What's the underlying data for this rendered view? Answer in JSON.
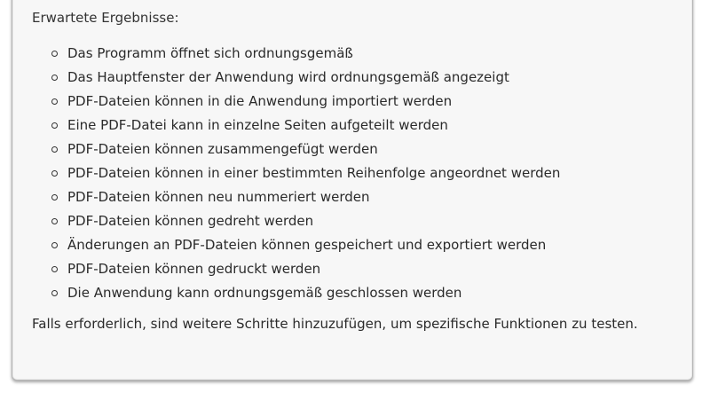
{
  "expected_results": {
    "heading": "Erwartete Ergebnisse:",
    "items": [
      "Das Programm öffnet sich ordnungsgemäß",
      "Das Hauptfenster der Anwendung wird ordnungsgemäß angezeigt",
      "PDF-Dateien können in die Anwendung importiert werden",
      "Eine PDF-Datei kann in einzelne Seiten aufgeteilt werden",
      "PDF-Dateien können zusammengefügt werden",
      "PDF-Dateien können in einer bestimmten Reihenfolge angeordnet werden",
      "PDF-Dateien können neu nummeriert werden",
      "PDF-Dateien können gedreht werden",
      "Änderungen an PDF-Dateien können gespeichert und exportiert werden",
      "PDF-Dateien können gedruckt werden",
      "Die Anwendung kann ordnungsgemäß geschlossen werden"
    ],
    "footer": "Falls erforderlich, sind weitere Schritte hinzuzufügen, um spezifische Funktionen zu testen."
  }
}
